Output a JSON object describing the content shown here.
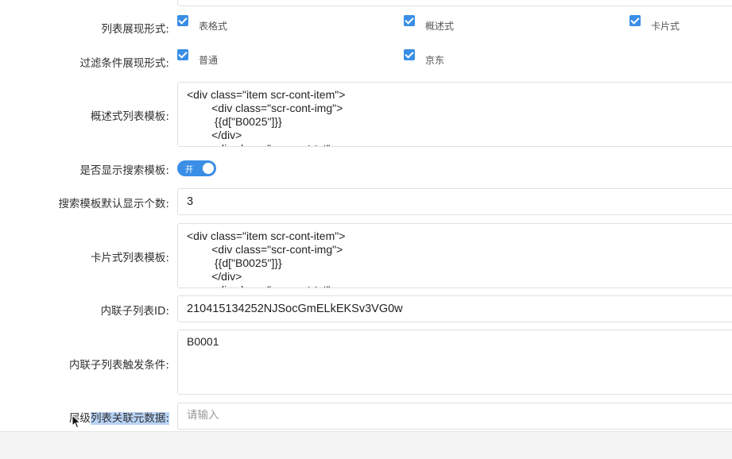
{
  "form": {
    "list_display": {
      "label": "列表展现形式:",
      "options": [
        {
          "label": "表格式",
          "checked": true
        },
        {
          "label": "概述式",
          "checked": true
        },
        {
          "label": "卡片式",
          "checked": true
        }
      ]
    },
    "filter_display": {
      "label": "过滤条件展现形式:",
      "options": [
        {
          "label": "普通",
          "checked": true
        },
        {
          "label": "京东",
          "checked": true
        }
      ]
    },
    "summary_template": {
      "label": "概述式列表模板:",
      "value": "<div class=\"item scr-cont-item\">\n        <div class=\"scr-cont-img\">\n         {{d[\"B0025\"]}}\n        </div>\n        <div class=\"scr-cont-txt\">"
    },
    "show_search_template": {
      "label": "是否显示搜索模板:",
      "switch_text": "开",
      "on": true
    },
    "search_default_count": {
      "label": "搜索模板默认显示个数:",
      "value": "3"
    },
    "card_template": {
      "label": "卡片式列表模板:",
      "value": "<div class=\"item scr-cont-item\">\n        <div class=\"scr-cont-img\">\n         {{d[\"B0025\"]}}\n        </div>\n        <div class=\"scr-cont-txt\">"
    },
    "inline_sublist_id": {
      "label": "内联子列表ID:",
      "value": "210415134252NJSocGmELkEKSv3VG0w"
    },
    "inline_sublist_condition": {
      "label": "内联子列表触发条件:",
      "value": "B0001"
    },
    "hierarchy_meta": {
      "label_prefix": "层级",
      "label_highlighted": "列表关联元数据",
      "label_suffix": ":",
      "placeholder": "请输入"
    }
  },
  "colors": {
    "accent": "#3a8ee6",
    "border": "#dcdfe6",
    "selection_highlight": "#b9d3f5"
  }
}
